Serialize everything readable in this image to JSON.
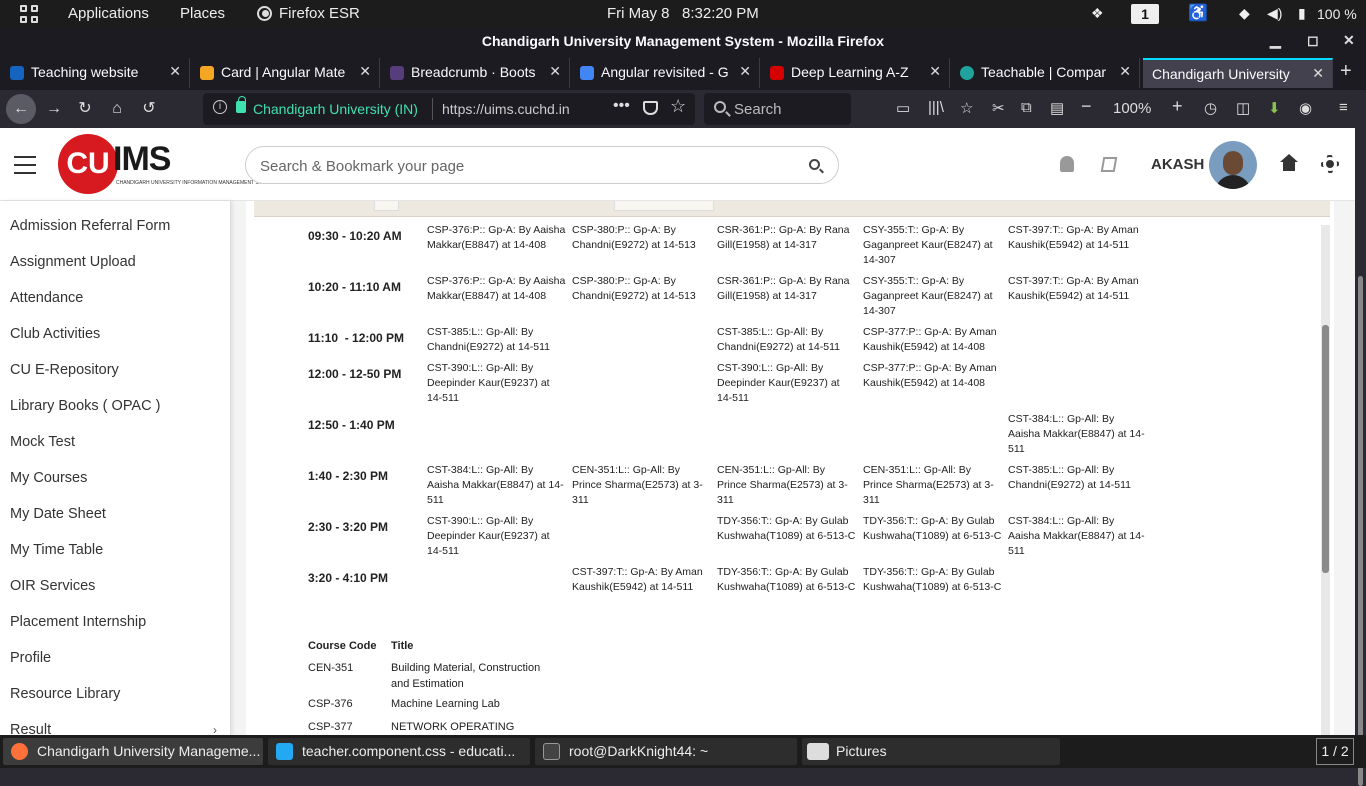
{
  "topbar": {
    "applications": "Applications",
    "places": "Places",
    "active_app": "Firefox ESR",
    "clock": "Fri May 8   8:32:20 PM",
    "workspace": "1",
    "battery": "100 %"
  },
  "window": {
    "title": "Chandigarh University Management System - Mozilla Firefox"
  },
  "tabs": [
    {
      "label": "Teaching website",
      "color": "#1565c0"
    },
    {
      "label": "Card | Angular Mate",
      "color": "#f5a623"
    },
    {
      "label": "Breadcrumb · Boots",
      "color": "#563d7c"
    },
    {
      "label": "Angular revisited - G",
      "color": "#4285f4"
    },
    {
      "label": "Deep Learning A-Z",
      "color": "#d50000"
    },
    {
      "label": "Teachable | Compar",
      "color": "#20a39e"
    },
    {
      "label": "Chandigarh University",
      "color": "#ffffff"
    }
  ],
  "nav": {
    "org": "Chandigarh University (IN)",
    "url": "https://uims.cuchd.in",
    "search_placeholder": "Search",
    "zoom": "100%"
  },
  "app": {
    "search_placeholder": "Search & Bookmark your page",
    "user": "AKASH",
    "logo_cu": "CU",
    "logo_ims": "IMS",
    "logo_sub": "CHANDIGARH UNIVERSITY INFORMATION MANAGEMENT SYSTEM"
  },
  "sidebar": {
    "items": [
      "Admission Referral Form",
      "Assignment Upload",
      "Attendance",
      "Club Activities",
      "CU E-Repository",
      "Library Books ( OPAC )",
      "Mock Test",
      "My Courses",
      "My Date Sheet",
      "My Time Table",
      "OIR Services",
      "Placement Internship",
      "Profile",
      "Resource Library",
      "Result"
    ]
  },
  "timetable": {
    "rows": [
      {
        "time": "09:30 - 10:20 AM",
        "cells": [
          "CSP-376:P:: Gp-A: By Aaisha Makkar(E8847) at 14-408",
          "CSP-380:P:: Gp-A: By Chandni(E9272) at 14-513",
          "CSR-361:P:: Gp-A: By Rana Gill(E1958) at 14-317",
          "CSY-355:T:: Gp-A: By Gaganpreet Kaur(E8247) at 14-307",
          "CST-397:T:: Gp-A: By Aman Kaushik(E5942) at 14-511"
        ]
      },
      {
        "time": "10:20 - 11:10 AM",
        "cells": [
          "CSP-376:P:: Gp-A: By Aaisha Makkar(E8847) at 14-408",
          "CSP-380:P:: Gp-A: By Chandni(E9272) at 14-513",
          "CSR-361:P:: Gp-A: By Rana Gill(E1958) at 14-317",
          "CSY-355:T:: Gp-A: By Gaganpreet Kaur(E8247) at 14-307",
          "CST-397:T:: Gp-A: By Aman Kaushik(E5942) at 14-511"
        ]
      },
      {
        "time": "11:10  - 12:00 PM",
        "cells": [
          "CST-385:L:: Gp-All: By Chandni(E9272) at 14-511",
          "",
          "CST-385:L:: Gp-All: By Chandni(E9272) at 14-511",
          "CSP-377:P:: Gp-A: By Aman Kaushik(E5942) at 14-408",
          ""
        ]
      },
      {
        "time": "12:00 - 12-50 PM",
        "cells": [
          "CST-390:L:: Gp-All: By Deepinder Kaur(E9237) at 14-511",
          "",
          "CST-390:L:: Gp-All: By Deepinder Kaur(E9237) at 14-511",
          "CSP-377:P:: Gp-A: By Aman Kaushik(E5942) at 14-408",
          ""
        ]
      },
      {
        "time": "12:50 - 1:40 PM",
        "cells": [
          "",
          "",
          "",
          "",
          "CST-384:L:: Gp-All: By Aaisha Makkar(E8847) at 14-511"
        ]
      },
      {
        "time": "1:40 - 2:30 PM",
        "cells": [
          "CST-384:L:: Gp-All: By Aaisha Makkar(E8847) at 14-511",
          "CEN-351:L:: Gp-All: By Prince Sharma(E2573) at 3-311",
          "CEN-351:L:: Gp-All: By Prince Sharma(E2573) at 3-311",
          "CEN-351:L:: Gp-All: By Prince Sharma(E2573) at 3-311",
          "CST-385:L:: Gp-All: By Chandni(E9272) at 14-511"
        ]
      },
      {
        "time": "2:30 - 3:20 PM",
        "cells": [
          "CST-390:L:: Gp-All: By Deepinder Kaur(E9237) at 14-511",
          "",
          "TDY-356:T:: Gp-A: By Gulab Kushwaha(T1089) at 6-513-C",
          "TDY-356:T:: Gp-A: By Gulab Kushwaha(T1089) at 6-513-C",
          "CST-384:L:: Gp-All: By Aaisha Makkar(E8847) at 14-511"
        ]
      },
      {
        "time": "3:20 - 4:10 PM",
        "cells": [
          "",
          "CST-397:T:: Gp-A: By Aman Kaushik(E5942) at 14-511",
          "TDY-356:T:: Gp-A: By Gulab Kushwaha(T1089) at 6-513-C",
          "TDY-356:T:: Gp-A: By Gulab Kushwaha(T1089) at 6-513-C",
          ""
        ]
      }
    ]
  },
  "courses": {
    "header_code": "Course Code",
    "header_title": "Title",
    "rows": [
      {
        "code": "CEN-351",
        "title": "Building Material, Construction and Estimation"
      },
      {
        "code": "CSP-376",
        "title": "Machine Learning Lab"
      },
      {
        "code": "CSP-377",
        "title": "NETWORK OPERATING"
      }
    ]
  },
  "taskbar": {
    "items": [
      {
        "label": "Chandigarh University Manageme...",
        "color": "#ff7139"
      },
      {
        "label": "teacher.component.css - educati...",
        "color": "#23a9f2"
      },
      {
        "label": "root@DarkKnight44: ~",
        "color": "#444444"
      },
      {
        "label": "Pictures",
        "color": "#dddddd"
      }
    ],
    "pager": "1 / 2"
  }
}
